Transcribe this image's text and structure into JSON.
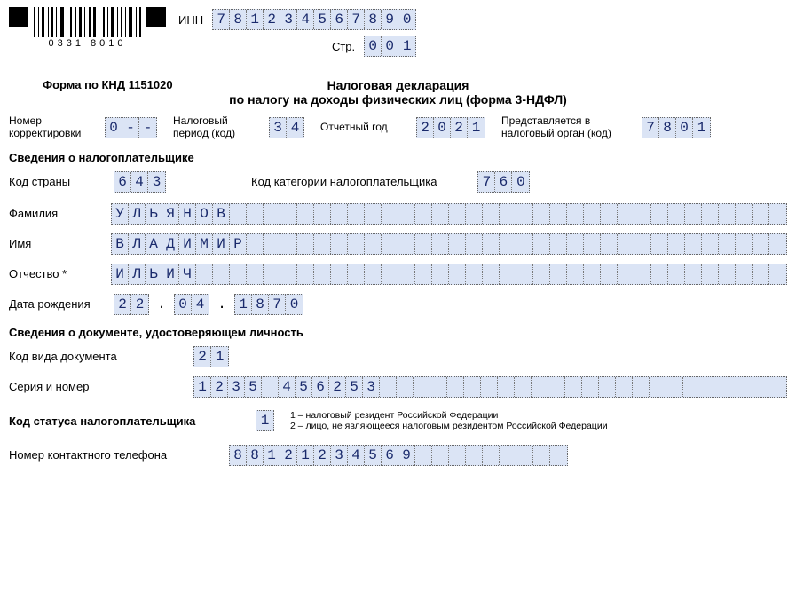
{
  "header": {
    "barcode_number": "0331  8010",
    "inn_label": "ИНН",
    "inn": "781234567890",
    "page_label": "Стр.",
    "page": "001"
  },
  "form_code": "Форма по КНД 1151020",
  "title_line1": "Налоговая декларация",
  "title_line2": "по налогу на доходы физических лиц (форма 3-НДФЛ)",
  "row1": {
    "correction_label": "Номер\nкорректировки",
    "correction": "0--",
    "period_label": "Налоговый\nпериод (код)",
    "period": "34",
    "year_label": "Отчетный год",
    "year": "2021",
    "organ_label": "Представляется в\nналоговый орган (код)",
    "organ": "7801"
  },
  "section_taxpayer": "Сведения о налогоплательщике",
  "country": {
    "label": "Код страны",
    "value": "643"
  },
  "category": {
    "label": "Код категории налогоплательщика",
    "value": "760"
  },
  "surname": {
    "label": "Фамилия",
    "value": "УЛЬЯНОВ"
  },
  "name": {
    "label": "Имя",
    "value": "ВЛАДИМИР"
  },
  "patronymic": {
    "label": "Отчество *",
    "value": "ИЛЬИЧ"
  },
  "dob": {
    "label": "Дата рождения",
    "d": "22",
    "m": "04",
    "y": "1870"
  },
  "section_doc": "Сведения о документе, удостоверяющем личность",
  "doc_type": {
    "label": "Код вида документа",
    "value": "21"
  },
  "doc_number": {
    "label": "Серия и номер",
    "part1": "1235",
    "part2": "456253"
  },
  "status": {
    "label": "Код статуса налогоплательщика",
    "value": "1",
    "note1": "1 – налоговый резидент Российской Федерации",
    "note2": "2 – лицо, не являющееся налоговым резидентом Российской Федерации"
  },
  "phone": {
    "label": "Номер контактного телефона",
    "value": "88121234569"
  },
  "name_field_cells": 40,
  "doc_number_total_cells": 30
}
